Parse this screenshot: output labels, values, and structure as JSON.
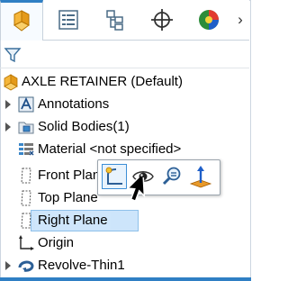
{
  "tabs": [
    {
      "name": "FeatureManager Design Tree",
      "icon": "feature-manager-icon",
      "active": true
    },
    {
      "name": "PropertyManager",
      "icon": "property-manager-icon",
      "active": false
    },
    {
      "name": "ConfigurationManager",
      "icon": "configuration-manager-icon",
      "active": false
    },
    {
      "name": "DimXpertManager",
      "icon": "dimxpert-icon",
      "active": false
    },
    {
      "name": "DisplayManager",
      "icon": "display-manager-icon",
      "active": false
    }
  ],
  "tab_more_glyph": "›",
  "filter_icon": "filter-icon",
  "tree": {
    "root": "AXLE RETAINER  (Default)",
    "items": {
      "annotations": "Annotations",
      "solid_bodies": "Solid Bodies(1)",
      "material": "Material <not specified>",
      "front_plane": "Front Plane",
      "top_plane": "Top Plane",
      "right_plane": "Right Plane",
      "origin": "Origin",
      "revolve": "Revolve-Thin1"
    }
  },
  "context_toolbar": {
    "buttons": [
      "sketch-icon",
      "show-icon",
      "zoom-to-selection-icon",
      "normal-to-icon"
    ]
  },
  "colors": {
    "accent": "#2f7fc4",
    "selection_fill": "#cde5fb",
    "selection_border": "#8ec0ea",
    "part_icon": "#f0a020"
  }
}
